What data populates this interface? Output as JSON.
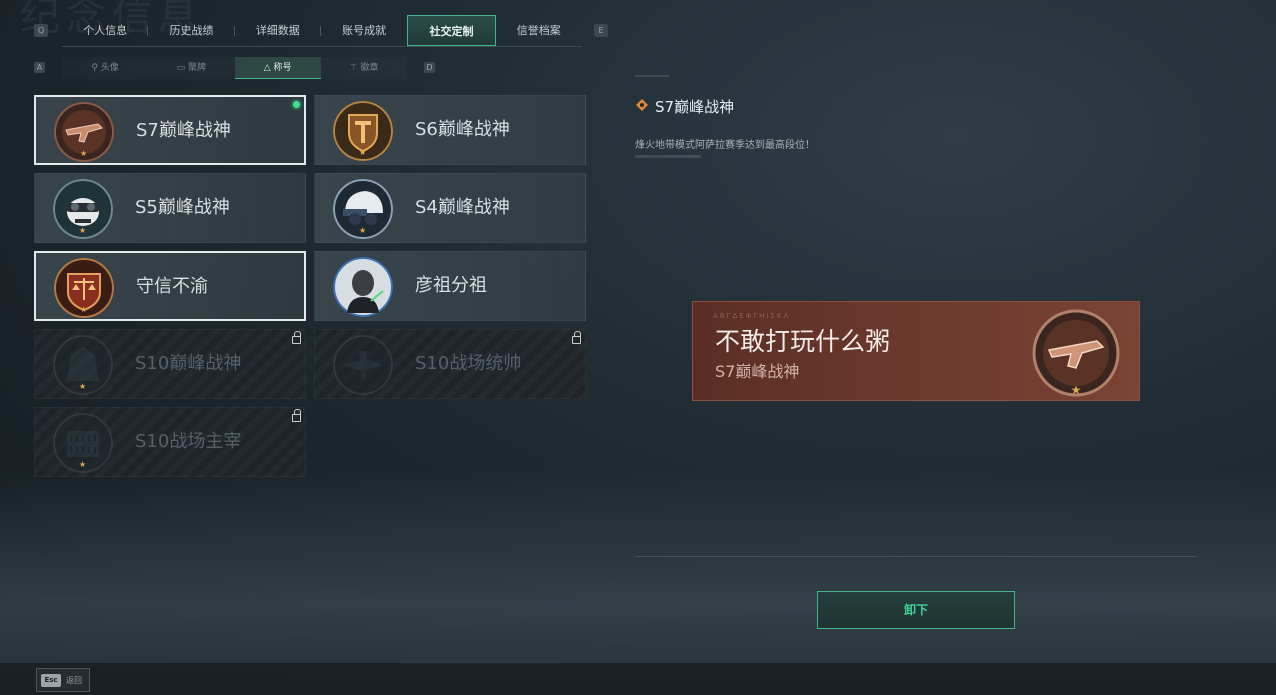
{
  "page_bg_title": "纪念信息",
  "top_tabs": {
    "left_key": "Q",
    "right_key": "E",
    "items": [
      {
        "label": "个人信息"
      },
      {
        "label": "历史战绩"
      },
      {
        "label": "详细数据"
      },
      {
        "label": "账号成就"
      },
      {
        "label": "社交定制",
        "active": true
      },
      {
        "label": "信誉档案"
      }
    ]
  },
  "sub_tabs": {
    "left_key": "A",
    "right_key": "D",
    "items": [
      {
        "label": "头像",
        "icon": "person-icon"
      },
      {
        "label": "聚牌",
        "icon": "card-icon"
      },
      {
        "label": "称号",
        "icon": "triangle-icon",
        "active": true
      },
      {
        "label": "徽章",
        "icon": "emblem-icon"
      }
    ]
  },
  "titles": [
    {
      "name": "S7巅峰战神",
      "selected": true,
      "equipped": true,
      "locked": false,
      "badge": "rifle-badge-icon"
    },
    {
      "name": "S6巅峰战神",
      "selected": false,
      "equipped": false,
      "locked": false,
      "badge": "shield-badge-icon"
    },
    {
      "name": "S5巅峰战神",
      "selected": false,
      "equipped": false,
      "locked": false,
      "badge": "skull-goggles-badge-icon"
    },
    {
      "name": "S4巅峰战神",
      "selected": false,
      "equipped": false,
      "locked": false,
      "badge": "helmet-badge-icon"
    },
    {
      "name": "守信不渝",
      "selected": true,
      "equipped": false,
      "locked": false,
      "badge": "scales-badge-icon"
    },
    {
      "name": "彦祖分祖",
      "selected": false,
      "equipped": false,
      "locked": false,
      "badge": "portrait-badge-icon"
    },
    {
      "name": "S10巅峰战神",
      "selected": false,
      "equipped": false,
      "locked": true,
      "badge": "monument-badge-icon"
    },
    {
      "name": "S10战场统帅",
      "selected": false,
      "equipped": false,
      "locked": true,
      "badge": "aircraft-badge-icon"
    },
    {
      "name": "S10战场主宰",
      "selected": false,
      "equipped": false,
      "locked": true,
      "badge": "colosseum-badge-icon"
    }
  ],
  "detail": {
    "title": "S7巅峰战神",
    "description": "烽火地带模式阿萨拉赛季达到最高段位！",
    "banner_player_name": "不敢打玩什么粥",
    "banner_title": "S7巅峰战神",
    "banner_faint_text": "ΑΒΓΔΕΦΓΗΙΣΚΛ",
    "action_button": "卸下"
  },
  "footer": {
    "esc_key": "Esc",
    "back_label": "返回"
  },
  "colors": {
    "accent": "#3fb58d",
    "equipped_dot": "#3ee28e",
    "banner_bg": "#6e3a2e",
    "star": "#e0a94a"
  }
}
